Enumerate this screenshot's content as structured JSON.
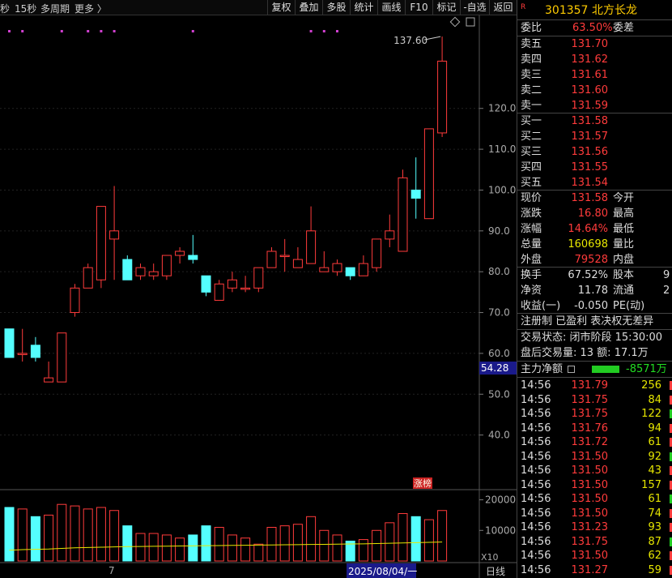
{
  "toolbar": {
    "left": [
      "秒",
      "15秒",
      "多周期",
      "更多 〉"
    ],
    "buttons": [
      "复权",
      "叠加",
      "多股",
      "统计",
      "画线",
      "F10",
      "标记",
      "-自选",
      "返回"
    ]
  },
  "chart": {
    "y_ticks": [
      "120.0",
      "110.0",
      "100.0",
      "90.0",
      "80.0",
      "70.0",
      "60.0",
      "50.0",
      "40.0"
    ],
    "max_label": "137.60",
    "current_price_tag": "54.28",
    "zhangbang_label": "涨榜",
    "vol_ticks": [
      "20000",
      "10000"
    ],
    "vol_unit": "X10",
    "x_labels": [
      "7",
      "2025/08/04/一"
    ],
    "period_label": "日线"
  },
  "chart_data": {
    "type": "candlestick",
    "ylim": [
      30,
      140
    ],
    "candles": [
      {
        "o": 66,
        "c": 59,
        "h": 66,
        "l": 59
      },
      {
        "o": 60,
        "c": 60,
        "h": 66,
        "l": 58
      },
      {
        "o": 62,
        "c": 59,
        "h": 64,
        "l": 58
      },
      {
        "o": 53,
        "c": 54,
        "h": 58,
        "l": 53
      },
      {
        "o": 53,
        "c": 65,
        "h": 65,
        "l": 53
      },
      {
        "o": 70,
        "c": 76,
        "h": 77,
        "l": 69
      },
      {
        "o": 76,
        "c": 81,
        "h": 82,
        "l": 76
      },
      {
        "o": 78,
        "c": 96,
        "h": 96,
        "l": 76
      },
      {
        "o": 88,
        "c": 90,
        "h": 101,
        "l": 78
      },
      {
        "o": 83,
        "c": 78,
        "h": 84,
        "l": 78
      },
      {
        "o": 79,
        "c": 81,
        "h": 82,
        "l": 78
      },
      {
        "o": 79,
        "c": 80,
        "h": 82,
        "l": 78
      },
      {
        "o": 79,
        "c": 84,
        "h": 84,
        "l": 78
      },
      {
        "o": 84,
        "c": 85,
        "h": 86,
        "l": 82
      },
      {
        "o": 84,
        "c": 83,
        "h": 89,
        "l": 82
      },
      {
        "o": 79,
        "c": 75,
        "h": 79,
        "l": 74
      },
      {
        "o": 73,
        "c": 77,
        "h": 78,
        "l": 73
      },
      {
        "o": 76,
        "c": 78,
        "h": 80,
        "l": 75
      },
      {
        "o": 76,
        "c": 76,
        "h": 79,
        "l": 75
      },
      {
        "o": 76,
        "c": 81,
        "h": 81,
        "l": 75
      },
      {
        "o": 81,
        "c": 85,
        "h": 86,
        "l": 81
      },
      {
        "o": 84,
        "c": 84,
        "h": 88,
        "l": 80
      },
      {
        "o": 81,
        "c": 83,
        "h": 86,
        "l": 81
      },
      {
        "o": 82,
        "c": 90,
        "h": 96,
        "l": 82
      },
      {
        "o": 80,
        "c": 81,
        "h": 85,
        "l": 80
      },
      {
        "o": 80,
        "c": 82,
        "h": 83,
        "l": 79
      },
      {
        "o": 81,
        "c": 79,
        "h": 81,
        "l": 78
      },
      {
        "o": 79,
        "c": 82,
        "h": 84,
        "l": 79
      },
      {
        "o": 81,
        "c": 88,
        "h": 88,
        "l": 80
      },
      {
        "o": 88,
        "c": 90,
        "h": 94,
        "l": 86
      },
      {
        "o": 85,
        "c": 103,
        "h": 105,
        "l": 85
      },
      {
        "o": 100,
        "c": 98,
        "h": 108,
        "l": 93
      },
      {
        "o": 93,
        "c": 115,
        "h": 115,
        "l": 93
      },
      {
        "o": 114,
        "c": 131.58,
        "h": 137.6,
        "l": 113
      }
    ],
    "volumes": [
      17500,
      17000,
      14500,
      15000,
      18500,
      18000,
      17000,
      17500,
      16500,
      11500,
      9000,
      9000,
      8500,
      7500,
      8500,
      11500,
      11000,
      8500,
      7500,
      5500,
      11000,
      11500,
      12000,
      14500,
      10000,
      8500,
      6500,
      7000,
      10000,
      12500,
      15500,
      14500,
      13500,
      16500
    ],
    "avg_volume": [
      3500,
      3700,
      3800,
      3900,
      4100,
      4300,
      4400,
      4500,
      4600,
      4700,
      4750,
      4800,
      4850,
      4900,
      4950,
      5000,
      5050,
      5100,
      5150,
      5200,
      5250,
      5300,
      5350,
      5400,
      5450,
      5500,
      5550,
      5600,
      5700,
      5800,
      5900,
      6000,
      6100,
      6200
    ],
    "vol_ylim": [
      0,
      22000
    ]
  },
  "panel": {
    "stock_code": "301357",
    "stock_name": "北方长龙",
    "weibi_label": "委比",
    "weibi_value": "63.50%",
    "weicha_label": "委差",
    "asks": [
      {
        "label": "卖五",
        "price": "131.70"
      },
      {
        "label": "卖四",
        "price": "131.62"
      },
      {
        "label": "卖三",
        "price": "131.61"
      },
      {
        "label": "卖二",
        "price": "131.60"
      },
      {
        "label": "卖一",
        "price": "131.59"
      }
    ],
    "bids": [
      {
        "label": "买一",
        "price": "131.58"
      },
      {
        "label": "买二",
        "price": "131.57"
      },
      {
        "label": "买三",
        "price": "131.56"
      },
      {
        "label": "买四",
        "price": "131.55"
      },
      {
        "label": "买五",
        "price": "131.54"
      }
    ],
    "stats": [
      {
        "l1": "现价",
        "v1": "131.58",
        "l2": "今开",
        "c": "red"
      },
      {
        "l1": "涨跌",
        "v1": "16.80",
        "l2": "最高",
        "c": "red"
      },
      {
        "l1": "涨幅",
        "v1": "14.64%",
        "l2": "最低",
        "c": "red"
      },
      {
        "l1": "总量",
        "v1": "160698",
        "l2": "量比",
        "c": "yel"
      },
      {
        "l1": "外盘",
        "v1": "79528",
        "l2": "内盘",
        "c": "red"
      }
    ],
    "stats2": [
      {
        "l1": "换手",
        "v1": "67.52%",
        "l2": "股本",
        "v2": "9"
      },
      {
        "l1": "净资",
        "v1": "11.78",
        "l2": "流通",
        "v2": "2"
      },
      {
        "l1": "收益(一)",
        "v1": "-0.050",
        "l2": "PE(动)",
        "v2": ""
      }
    ],
    "notes": "注册制 已盈利 表决权无差异",
    "trade_status": "交易状态: 闭市阶段 15:30:00",
    "after_hours": "盘后交易量: 13  额: 17.1万",
    "main_flow_label": "主力净额",
    "main_flow_value": "-8571万",
    "ticks": [
      {
        "t": "14:56",
        "p": "131.79",
        "v": "256"
      },
      {
        "t": "14:56",
        "p": "131.75",
        "v": "84"
      },
      {
        "t": "14:56",
        "p": "131.75",
        "v": "122"
      },
      {
        "t": "14:56",
        "p": "131.76",
        "v": "94"
      },
      {
        "t": "14:56",
        "p": "131.72",
        "v": "61"
      },
      {
        "t": "14:56",
        "p": "131.50",
        "v": "92"
      },
      {
        "t": "14:56",
        "p": "131.50",
        "v": "43"
      },
      {
        "t": "14:56",
        "p": "131.50",
        "v": "157"
      },
      {
        "t": "14:56",
        "p": "131.50",
        "v": "61"
      },
      {
        "t": "14:56",
        "p": "131.50",
        "v": "74"
      },
      {
        "t": "14:56",
        "p": "131.23",
        "v": "93"
      },
      {
        "t": "14:56",
        "p": "131.75",
        "v": "87"
      },
      {
        "t": "14:56",
        "p": "131.50",
        "v": "62"
      },
      {
        "t": "14:56",
        "p": "131.27",
        "v": "59"
      }
    ],
    "colors": {
      "up": "#ff3b3b",
      "down": "#54ffff",
      "ma": "#e6e600"
    }
  }
}
